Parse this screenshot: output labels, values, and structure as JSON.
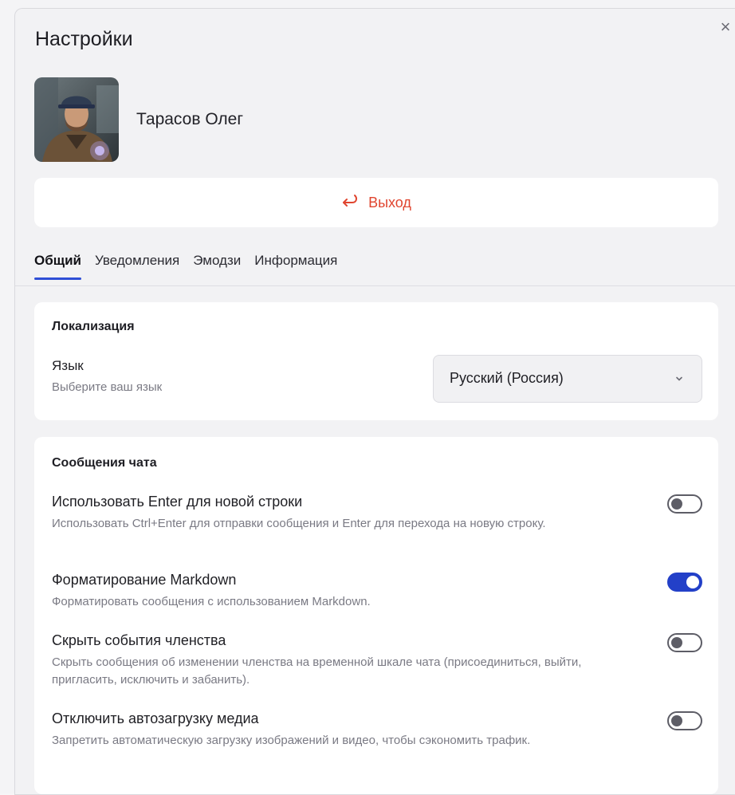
{
  "dialog": {
    "title": "Настройки",
    "close_icon": "close-icon"
  },
  "profile": {
    "name": "Тарасов Олег",
    "avatar_icon": "user-avatar-photo"
  },
  "logout": {
    "label": "Выход",
    "icon": "logout-arrow-icon",
    "color": "#e0452f"
  },
  "tabs": [
    {
      "label": "Общий",
      "active": true
    },
    {
      "label": "Уведомления",
      "active": false
    },
    {
      "label": "Эмодзи",
      "active": false
    },
    {
      "label": "Информация",
      "active": false
    }
  ],
  "localization": {
    "title": "Локализация",
    "language_label": "Язык",
    "language_hint": "Выберите ваш язык",
    "language_value": "Русский (Россия)"
  },
  "chat": {
    "title": "Сообщения чата",
    "settings": [
      {
        "title": "Использовать Enter для новой строки",
        "description": "Использовать Ctrl+Enter для отправки сообщения и Enter для перехода на новую строку.",
        "enabled": false
      },
      {
        "title": "Форматирование Markdown",
        "description": "Форматировать сообщения с использованием Markdown.",
        "enabled": true
      },
      {
        "title": "Скрыть события членства",
        "description": "Скрыть сообщения об изменении членства на временной шкале чата (присоединиться, выйти, пригласить, исключить и забанить).",
        "enabled": false
      },
      {
        "title": "Отключить автозагрузку медиа",
        "description": "Запретить автоматическую загрузку изображений и видео, чтобы сэкономить трафик.",
        "enabled": false
      }
    ]
  },
  "colors": {
    "accent": "#2f4fd6",
    "toggle_on": "#2340c8",
    "danger": "#e0452f"
  }
}
